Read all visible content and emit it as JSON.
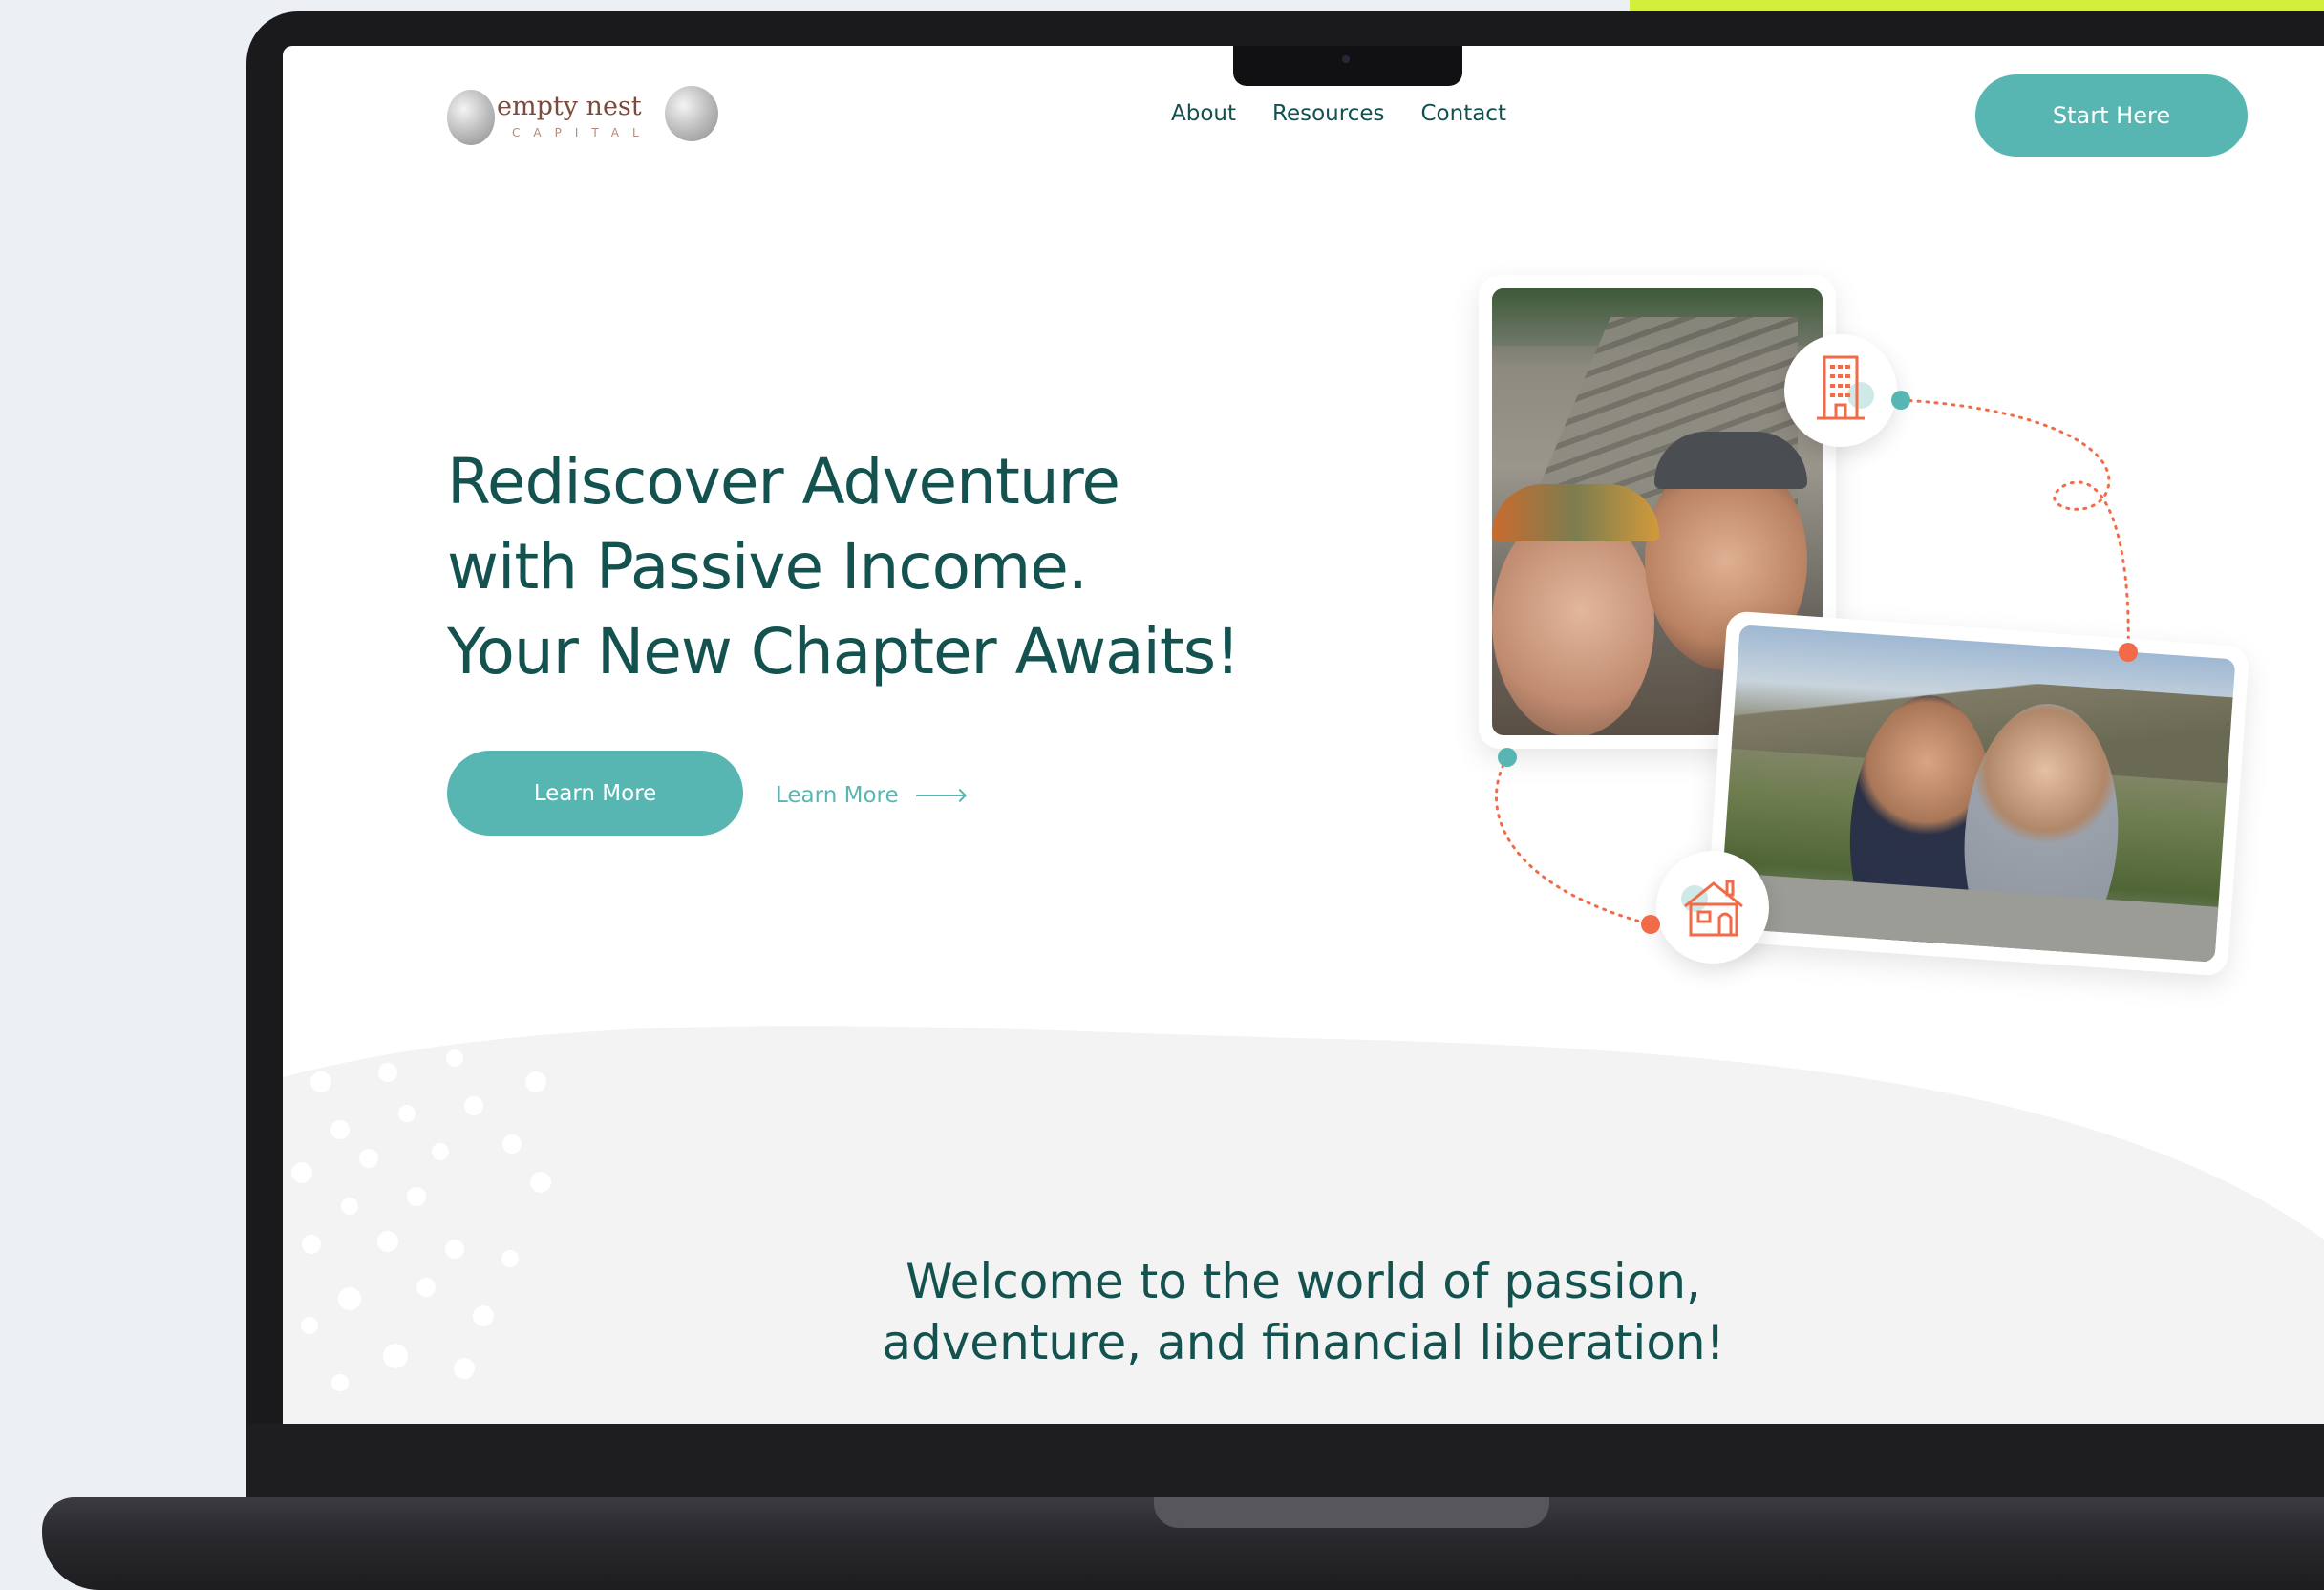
{
  "nav": {
    "logo_text": "empty nest",
    "logo_subtext": "CAPITAL",
    "links": [
      "About",
      "Resources",
      "Contact"
    ],
    "cta_label": "Start Here"
  },
  "hero": {
    "title_lines": [
      "Rediscover Adventure",
      "with Passive Income.",
      "Your New Chapter Awaits!"
    ],
    "primary_button": "Learn More",
    "secondary_link": "Learn More"
  },
  "icons": {
    "building": "building-icon",
    "house": "house-icon",
    "arrow": "arrow-right-icon"
  },
  "welcome": {
    "lines": [
      "Welcome to the world of passion,",
      "adventure, and financial liberation!"
    ]
  },
  "colors": {
    "teal": "#58b6b2",
    "dark_teal": "#13524f",
    "coral": "#f26b48",
    "accent": "#d4ef3a"
  }
}
